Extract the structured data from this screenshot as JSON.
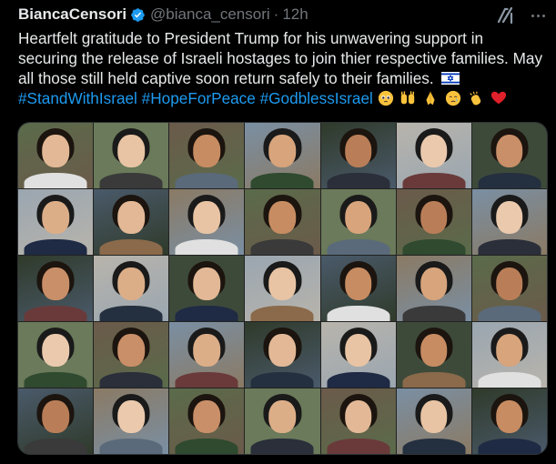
{
  "tweet": {
    "author_name": "BiancaCensori",
    "handle": "@bianca_censori",
    "separator": "·",
    "time": "12h",
    "lines": [
      "Heartfelt gratitude to President Trump for his unwavering support in",
      "securing the release of Israeli hostages to join thier respective families. May",
      "all those still held captive soon return safely to their families."
    ],
    "flag_emoji": "israel-flag-emoji",
    "hashtags": [
      "#StandWithIsrael",
      "#HopeForPeace",
      "#GodblessIsrael"
    ],
    "trailing_emojis": [
      "pleading-face-emoji",
      "raising-hands-emoji",
      "folded-hands-emoji",
      "crying-face-emoji",
      "clapping-hands-emoji",
      "red-heart-emoji"
    ]
  },
  "icons": {
    "verified": "verified-badge-icon",
    "grok": "grok-icon",
    "more": "more-icon"
  },
  "colors": {
    "background": "#000000",
    "text": "#e7e9ea",
    "muted": "#71767b",
    "accent": "#1d9bf0",
    "border": "#2f3336"
  },
  "media": {
    "description": "photo collage",
    "rows": 5,
    "columns": 7,
    "count": 35
  }
}
